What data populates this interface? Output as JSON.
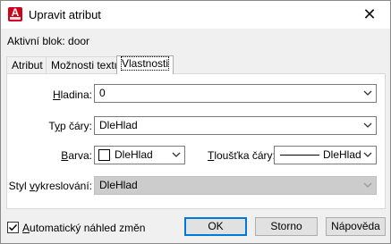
{
  "window": {
    "title": "Upravit atribut",
    "icon_letter": "A",
    "close_glyph": "✕"
  },
  "active_block": "Aktivní blok: door",
  "tabs": [
    {
      "label": "Atribut",
      "active": false
    },
    {
      "label": "Možnosti textu",
      "active": false
    },
    {
      "label": "Vlastnosti",
      "active": true
    }
  ],
  "properties": {
    "layer": {
      "label_u": "H",
      "label_rest": "ladina:",
      "value": "0"
    },
    "linetype": {
      "label_a": "T",
      "label_u": "y",
      "label_rest": "p čáry:",
      "value": "DleHlad"
    },
    "color": {
      "label_u": "B",
      "label_rest": "arva:",
      "value": "DleHlad",
      "swatch": "#ffffff"
    },
    "lineweight": {
      "label_u": "T",
      "label_rest": "loušťka čáry:",
      "value": "DleHlad"
    },
    "plotstyle": {
      "label_a": "Styl ",
      "label_u": "v",
      "label_rest": "ykreslování:",
      "value": "DleHlad",
      "disabled": true
    }
  },
  "auto_preview": {
    "label_u": "A",
    "label_rest": "utomatický náhled změn",
    "checked": true
  },
  "buttons": {
    "ok": "OK",
    "cancel": "Storno",
    "help": "Nápověda"
  },
  "colors": {
    "app_icon": "#d0021b",
    "focus_border": "#0078d7",
    "disabled_field": "#cccccc"
  },
  "icons": [
    "app-autocad-icon",
    "close-icon",
    "chevron-down-icon",
    "checkmark-icon"
  ]
}
